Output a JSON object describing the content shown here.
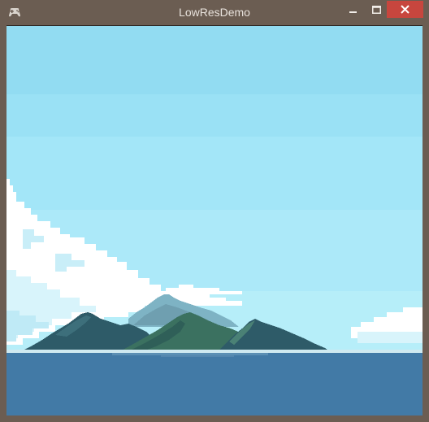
{
  "window": {
    "title": "LowResDemo",
    "controls": {
      "minimize": "minimize-icon",
      "maximize": "maximize-icon",
      "close": "close-icon"
    }
  },
  "colors": {
    "frame": "#6b5d52",
    "close_button": "#c7463e",
    "sky_top": "#92dcf2",
    "sky_bottom": "#b6eef9",
    "sea": "#427aa6",
    "mountain_dark": "#2e5b68",
    "mountain_green": "#3b7160",
    "mountain_haze": "#6f9fb0",
    "cloud": "#ffffff",
    "cloud_shade": "#d8f4fb"
  }
}
